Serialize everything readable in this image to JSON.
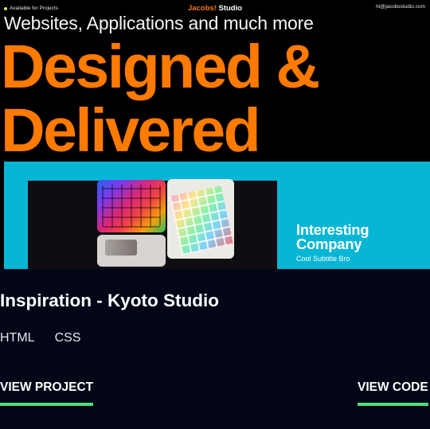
{
  "preview": {
    "availability": "Available for Projects",
    "brand_part1": "Jacobs!",
    "brand_part2": "Studio",
    "email": "hi@jacobsstudio.com",
    "tagline": "Websites, Applications and much more",
    "hero_line1": "Designed &",
    "hero_line2": "Delivered",
    "showcase": {
      "company_line1": "Interesting",
      "company_line2": "Company",
      "subtitle": "Cool Subtitle Bro"
    }
  },
  "project": {
    "title": "Inspiration - Kyoto Studio",
    "tags": [
      "HTML",
      "CSS"
    ]
  },
  "actions": {
    "view_project": "VIEW PROJECT",
    "view_code": "VIEW CODE"
  },
  "colors": {
    "accent": "#4ade80",
    "hero": "#ff7a00",
    "showcase_bg": "#06b6d4",
    "page_bg": "#020617"
  }
}
